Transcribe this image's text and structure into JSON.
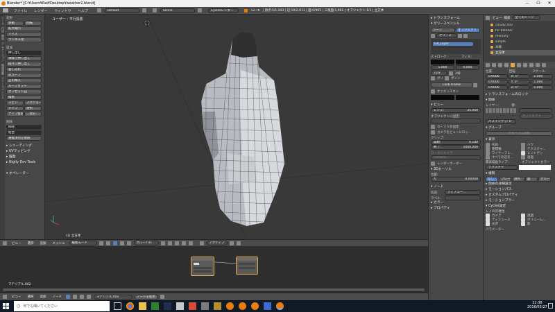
{
  "window": {
    "title": "Blender* [C:¥Users¥Rai¥Desktop¥weather2.blend]",
    "minimize": "—",
    "maximize": "☐",
    "close": "✕"
  },
  "menu": {
    "items": [
      "ファイル",
      "レンダー",
      "ウィンドウ",
      "ヘルプ"
    ],
    "layout": "Default",
    "scene": "Scene",
    "engine": "Cyclesレンダー",
    "version": "v2.76",
    "stats": "| 頂点:5/1,043 | 辺:10/2,011 | 面:0/965 | 三角面:1,961 | オブジェクト:1/1 | 立方体"
  },
  "shelf": {
    "tabs": [
      "ツール",
      "作成",
      "関係",
      "アニメーション",
      "物理演算",
      "グリースペンシル"
    ],
    "sections": [
      {
        "title": "変形",
        "items": [
          "移動",
          "回転",
          "拡大縮小",
          "ノイズ",
          "ランダム化"
        ]
      },
      {
        "title": "追加",
        "items": [
          "押し出し",
          "領域で押し出し",
          "個々に押し出し",
          "差し込む",
          "辺ループ",
          "辺の挿入",
          "ループカット",
          "オフセット辺",
          "複製",
          "スピン",
          "スクリュー",
          "ナイフ",
          "選択",
          "ナイフ投影",
          "二等分"
        ]
      },
      {
        "title": "削除",
        "items": [
          "削除",
          "結合",
          "重複頂点を削除"
        ]
      },
      {
        "title": "シェーディング",
        "items": []
      },
      {
        "title": "UVマッピング",
        "items": []
      },
      {
        "title": "履歴",
        "items": []
      },
      {
        "title": "Nigtly Dev Tools",
        "items": []
      },
      {
        "title": "オペレーター",
        "items": []
      }
    ]
  },
  "viewport": {
    "title": "ユーザー・平行投影",
    "status": "(1) 立方体",
    "header": [
      "ビュー",
      "選択",
      "追加",
      "メッシュ"
    ],
    "mode": "編集モード",
    "orientation": "グローバル",
    "pivot": "アクティブ"
  },
  "props_panel": {
    "transform": "トランスフォーム",
    "grease": "グリースペンシル",
    "tabs": [
      "シーン",
      "オブジェクト"
    ],
    "grease_name": "グリース",
    "layer": "GP_Layer",
    "stroke": "ストローク:",
    "fill": "フィル:",
    "opacity_a": "0.000",
    "opacity_b": "1.000",
    "thickness": "3 px",
    "xray": "X線",
    "volumetric": "ボリ",
    "point": "ポイン",
    "lock": "Lock Frame",
    "onion": "オニオンスキン",
    "view": "ビュー",
    "lens": "レンズ:",
    "lens_val": "35.000",
    "lock_to_obj": "オブジェクトに固定:",
    "lock_cursor": "カーソルを固定",
    "lock_camera": "カメラをビューにロッ...",
    "clip": "クリップ:",
    "clip_start": "開始:",
    "clip_start_val": "0.100",
    "clip_end": "終了:",
    "clip_end_val": "1000.000",
    "local_camera": "ローカルカメラ",
    "camera": "Camera",
    "render_border": "レンダーボーダー",
    "cursor3d": "3Dカーソル",
    "location": "位置:",
    "x": "X:",
    "x_val": "0.00000",
    "node": "ノード",
    "name": "名前:",
    "name_val": "ディフュー...",
    "label": "ラベル:",
    "color": "カラー",
    "properties": "プロパティ"
  },
  "outliner": {
    "header": [
      "ビュー",
      "検索",
      "全てのシーン"
    ],
    "items": [
      "cloud2.002",
      "for blender",
      "memory",
      "simple",
      "木曜",
      "立方体"
    ]
  },
  "object_props": {
    "position": "位置:",
    "rotation": "回転:",
    "scale": "スケール:",
    "loc": [
      "0.0000",
      "0.0000",
      "0.0000"
    ],
    "rot": [
      "0°",
      "0°",
      "0°"
    ],
    "scl": [
      "1.000",
      "1.000",
      "1.000"
    ],
    "axis": [
      "X:",
      "Y:",
      "Z:"
    ],
    "delta": "トランスフォームのロック",
    "relations": "関係",
    "layer": "レイヤー:",
    "parent": "親:",
    "object": "オブジェクト",
    "pass_index": "パスインデッ: 0",
    "groups": "グループ",
    "add_to_group": "グループに追加",
    "display": "表示",
    "name": "名前",
    "bounds": "バウ",
    "axis2": "座標軸",
    "texture_space": "テクスチャ...",
    "wire": "ワイヤーフレ...",
    "xray": "レントゲン",
    "all_edges": "すべての辺を...",
    "transparency": "透過",
    "max_draw": "最高描画タイプ:",
    "obj_color": "オブジェクトカラー",
    "texture": "テクスチャ",
    "duplication": "複製",
    "dup_opts": [
      "なし",
      "フレー",
      "頂点",
      "面",
      "グルー"
    ],
    "relations_extra": "関係の詳細設定",
    "motion_path": "モーションパス",
    "custom_props": "カスタムプロパティ",
    "motion_blur": "モーションブラー",
    "cycles": "Cycles設定",
    "ray_vis": "レイの可視性:",
    "vis_a": [
      "カメラ",
      "ディフューズ",
      "光沢"
    ],
    "vis_b": [
      "透過",
      "ボリューム...",
      "影"
    ],
    "params": "パラメーター"
  },
  "node_editor": {
    "material": "マテリアル.002",
    "header": [
      "ビュー",
      "選択",
      "追加",
      "ノード"
    ],
    "mat_field": "マテリアル.002",
    "use_nodes": "ノードを使用"
  },
  "taskbar": {
    "search": "何でも聞いてください",
    "time": "22:38",
    "date": "2016/05/27"
  }
}
